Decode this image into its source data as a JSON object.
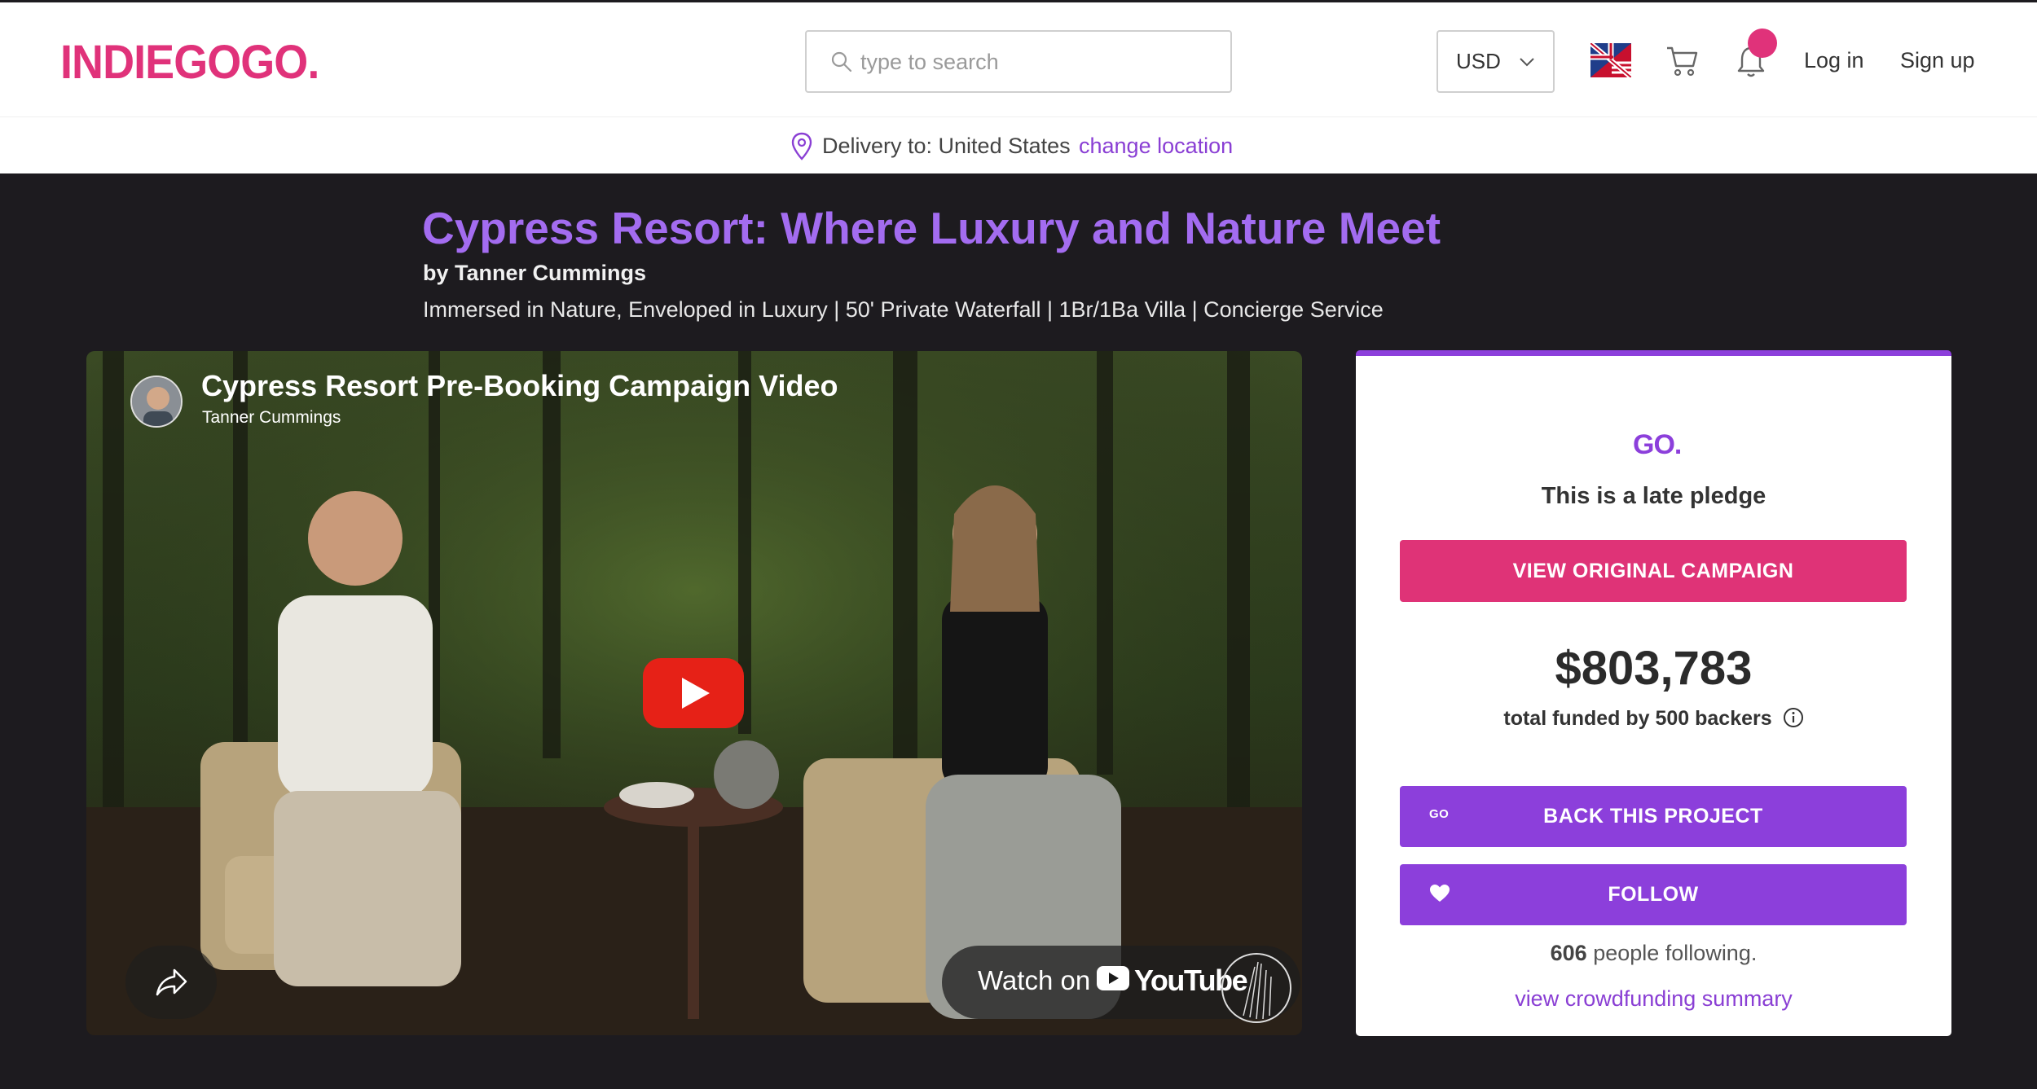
{
  "header": {
    "logo": "INDIEGOGO",
    "logo_dot": ".",
    "search_placeholder": "type to search",
    "currency": "USD",
    "login": "Log in",
    "signup": "Sign up"
  },
  "delivery": {
    "text": "Delivery to: United States",
    "change": "change location"
  },
  "campaign": {
    "title": "Cypress Resort: Where Luxury and Nature Meet",
    "byline": "by Tanner Cummings",
    "subtitle": "Immersed in Nature, Enveloped in Luxury | 50' Private Waterfall | 1Br/1Ba Villa | Concierge Service"
  },
  "video": {
    "title": "Cypress Resort Pre-Booking Campaign Video",
    "channel": "Tanner Cummings",
    "watch_on": "Watch on",
    "youtube": "YouTube"
  },
  "panel": {
    "go_mark": "GO.",
    "late_pledge": "This is a late pledge",
    "view_original": "VIEW ORIGINAL CAMPAIGN",
    "amount": "$803,783",
    "funded_text": "total funded by 500 backers",
    "back_label": "BACK THIS PROJECT",
    "back_icon_text": "GO",
    "follow_label": "FOLLOW",
    "following_count": "606",
    "following_text": "people following.",
    "summary_link": "view crowdfunding summary"
  },
  "colors": {
    "brand_pink": "#e0327a",
    "brand_purple": "#8c3fdb",
    "title_purple": "#a36cf0",
    "dark_bg": "#1d1b1f"
  }
}
